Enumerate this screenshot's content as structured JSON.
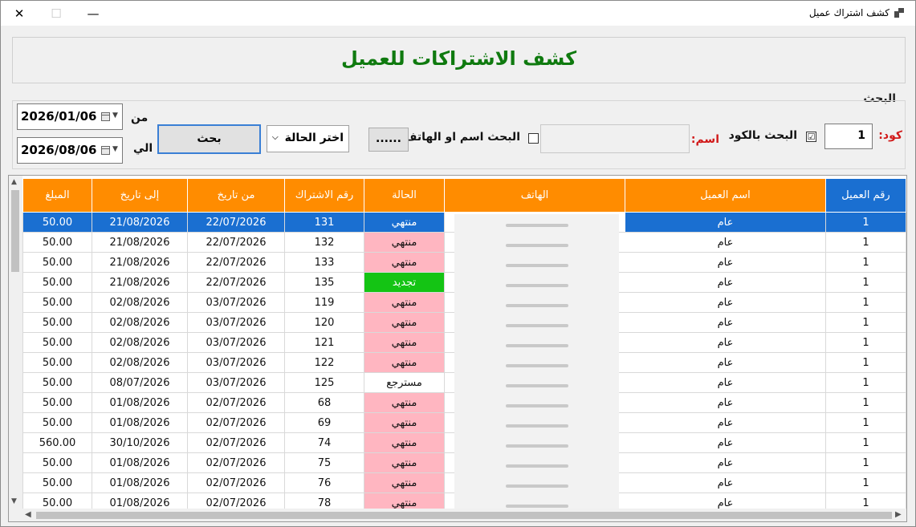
{
  "window": {
    "title": "كشف اشتراك عميل"
  },
  "header": {
    "heading": "كشف الاشتراكات للعميل"
  },
  "search": {
    "group_label": "البحث",
    "code_label": "كود:",
    "code_value": "1",
    "by_code_label": "البحث بالكود",
    "by_code_checked": "☑",
    "name_label": "اسم:",
    "name_value": "",
    "by_name_label": "البحث اسم او الهاتف",
    "by_name_checked": "",
    "dots_label": "......",
    "status_placeholder": "اختر الحالة",
    "search_button": "بحث",
    "from_label": "من",
    "to_label": "الي",
    "date_from": "2026/01/06",
    "date_to": "2026/08/06"
  },
  "grid": {
    "columns": [
      "رقم العميل",
      "اسم العميل",
      "الهاتف",
      "الحالة",
      "رقم الاشتراك",
      "من تاريخ",
      "إلى تاريخ",
      "المبلغ"
    ],
    "rows": [
      {
        "cust": "1",
        "name": "عام",
        "phone": "",
        "status": "منتهي",
        "sub": "131",
        "from": "22/07/2026",
        "to": "21/08/2026",
        "amount": "50.00"
      },
      {
        "cust": "1",
        "name": "عام",
        "phone": "",
        "status": "منتهي",
        "sub": "132",
        "from": "22/07/2026",
        "to": "21/08/2026",
        "amount": "50.00"
      },
      {
        "cust": "1",
        "name": "عام",
        "phone": "",
        "status": "منتهي",
        "sub": "133",
        "from": "22/07/2026",
        "to": "21/08/2026",
        "amount": "50.00"
      },
      {
        "cust": "1",
        "name": "عام",
        "phone": "",
        "status": "تجديد",
        "sub": "135",
        "from": "22/07/2026",
        "to": "21/08/2026",
        "amount": "50.00"
      },
      {
        "cust": "1",
        "name": "عام",
        "phone": "",
        "status": "منتهي",
        "sub": "119",
        "from": "03/07/2026",
        "to": "02/08/2026",
        "amount": "50.00"
      },
      {
        "cust": "1",
        "name": "عام",
        "phone": "",
        "status": "منتهي",
        "sub": "120",
        "from": "03/07/2026",
        "to": "02/08/2026",
        "amount": "50.00"
      },
      {
        "cust": "1",
        "name": "عام",
        "phone": "",
        "status": "منتهي",
        "sub": "121",
        "from": "03/07/2026",
        "to": "02/08/2026",
        "amount": "50.00"
      },
      {
        "cust": "1",
        "name": "عام",
        "phone": "",
        "status": "منتهي",
        "sub": "122",
        "from": "03/07/2026",
        "to": "02/08/2026",
        "amount": "50.00"
      },
      {
        "cust": "1",
        "name": "عام",
        "phone": "",
        "status": "مسترجع",
        "sub": "125",
        "from": "03/07/2026",
        "to": "08/07/2026",
        "amount": "50.00"
      },
      {
        "cust": "1",
        "name": "عام",
        "phone": "",
        "status": "منتهي",
        "sub": "68",
        "from": "02/07/2026",
        "to": "01/08/2026",
        "amount": "50.00"
      },
      {
        "cust": "1",
        "name": "عام",
        "phone": "",
        "status": "منتهي",
        "sub": "69",
        "from": "02/07/2026",
        "to": "01/08/2026",
        "amount": "50.00"
      },
      {
        "cust": "1",
        "name": "عام",
        "phone": "",
        "status": "منتهي",
        "sub": "74",
        "from": "02/07/2026",
        "to": "30/10/2026",
        "amount": "560.00"
      },
      {
        "cust": "1",
        "name": "عام",
        "phone": "",
        "status": "منتهي",
        "sub": "75",
        "from": "02/07/2026",
        "to": "01/08/2026",
        "amount": "50.00"
      },
      {
        "cust": "1",
        "name": "عام",
        "phone": "",
        "status": "منتهي",
        "sub": "76",
        "from": "02/07/2026",
        "to": "01/08/2026",
        "amount": "50.00"
      },
      {
        "cust": "1",
        "name": "عام",
        "phone": "",
        "status": "منتهي",
        "sub": "78",
        "from": "02/07/2026",
        "to": "01/08/2026",
        "amount": "50.00"
      }
    ],
    "selected_row": 0
  },
  "colors": {
    "header_orange": "#ff8c00",
    "header_blue": "#1a6fd1",
    "ended": "#ffb6c1",
    "renewed": "#14c414",
    "heading_green": "#0f7a0f"
  },
  "icons": {
    "close": "close-icon",
    "maximize": "maximize-icon",
    "minimize": "minimize-icon",
    "app": "app-icon"
  }
}
